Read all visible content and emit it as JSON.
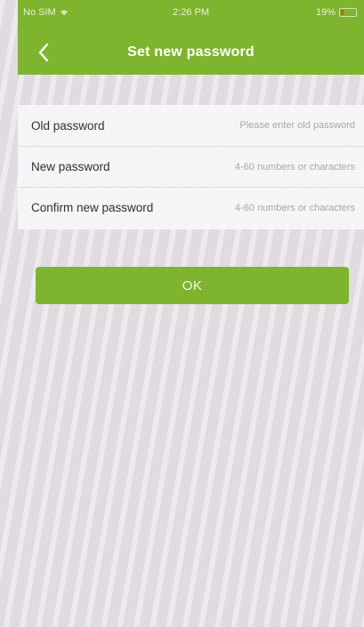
{
  "status_bar": {
    "carrier": "No SIM",
    "time": "2:26 PM",
    "battery": "19%"
  },
  "header": {
    "back_icon": "chevron-left-icon",
    "title": "Set new password"
  },
  "form": {
    "fields": [
      {
        "label": "Old password",
        "placeholder": "Please enter old password"
      },
      {
        "label": "New password",
        "placeholder": "4-60 numbers or characters"
      },
      {
        "label": "Confirm new password",
        "placeholder": "4-60 numbers or characters"
      }
    ]
  },
  "actions": {
    "ok_label": "OK"
  },
  "theme": {
    "brand_green": "#7fb42e",
    "background": "#e6e2e8"
  }
}
